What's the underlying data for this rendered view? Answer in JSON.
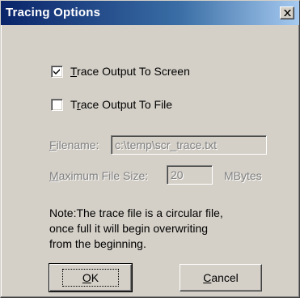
{
  "window": {
    "title": "Tracing Options",
    "close_glyph": "close-icon"
  },
  "options": {
    "trace_screen": {
      "label_first": "T",
      "label_rest": "race Output To Screen",
      "checked": true
    },
    "trace_file": {
      "label_first": "T",
      "label_ul": "r",
      "label_rest": "ace Output To File",
      "checked": false
    }
  },
  "filename": {
    "label_ul": "F",
    "label_rest": "ilename:",
    "value": "c:\\temp\\scr_trace.txt"
  },
  "max_size": {
    "label_ul": "M",
    "label_rest": "aximum File Size:",
    "value": "20",
    "unit": "MBytes"
  },
  "note": "Note:The trace file is a circular file,\nonce full it will begin overwriting\nfrom the beginning.",
  "buttons": {
    "ok_ul": "O",
    "ok_rest": "K",
    "cancel_ul": "C",
    "cancel_rest": "ancel"
  },
  "colors": {
    "titlebar_start": "#0a246a",
    "titlebar_end": "#a6caf0",
    "face": "#d4d0c8"
  }
}
